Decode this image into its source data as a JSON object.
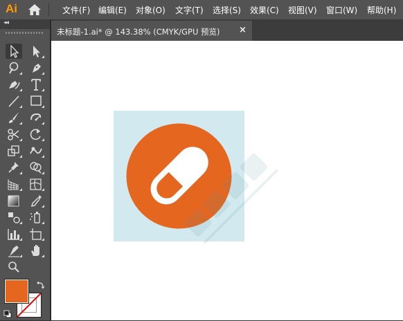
{
  "app": {
    "logo": "Ai"
  },
  "menu": [
    "文件(F)",
    "编辑(E)",
    "对象(O)",
    "文字(T)",
    "选择(S)",
    "效果(C)",
    "视图(V)",
    "窗口(W)",
    "帮助(H)"
  ],
  "document_tab": {
    "title": "未标题-1.ai* @ 143.38% (CMYK/GPU 预览)",
    "close": "×"
  },
  "tool_panel": {
    "collapse": "◂◂"
  },
  "colors": {
    "fill": "#e5661e",
    "stroke": "none",
    "artboard_bg": "#d2e9ef",
    "circle": "#e5661e",
    "pill": "#ffffff"
  },
  "tools": [
    "selection-tool-icon",
    "direct-selection-tool-icon",
    "magic-wand-icon",
    "pen-tool-icon",
    "curvature-tool-icon",
    "type-tool-icon",
    "line-segment-tool-icon",
    "rectangle-tool-icon",
    "paintbrush-tool-icon",
    "blob-brush-tool-icon",
    "scissors-tool-icon",
    "rotate-tool-icon",
    "scale-tool-icon",
    "warp-tool-icon",
    "pin-tool-icon",
    "shape-builder-tool-icon",
    "perspective-grid-icon",
    "mesh-tool-icon",
    "gradient-tool-icon",
    "eyedropper-tool-icon",
    "blend-tool-icon",
    "symbol-sprayer-icon",
    "column-graph-tool-icon",
    "artboard-tool-icon",
    "slice-tool-icon",
    "hand-tool-icon",
    "zoom-tool-icon"
  ]
}
